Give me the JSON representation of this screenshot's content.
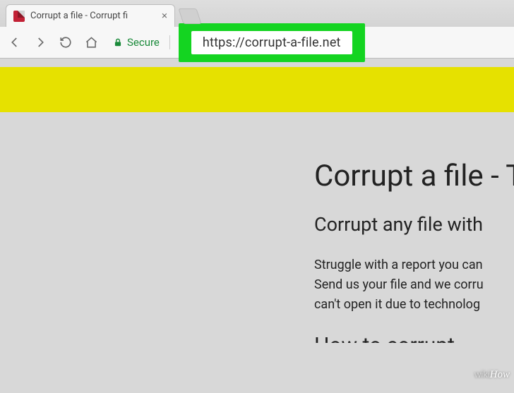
{
  "browser": {
    "tab": {
      "title": "Corrupt a file - Corrupt fi"
    },
    "toolbar": {
      "secure_label": "Secure",
      "url": "https://corrupt-a-file.net"
    }
  },
  "page": {
    "heading": "Corrupt a file - T",
    "subheading": "Corrupt any file with",
    "body_line1": "Struggle with a report you can",
    "body_line2": "Send us your file and we corru",
    "body_line3": "can't open it due to technolog",
    "heading2": "How to corrupt"
  },
  "watermark": {
    "prefix": "wiki",
    "suffix": "How"
  }
}
